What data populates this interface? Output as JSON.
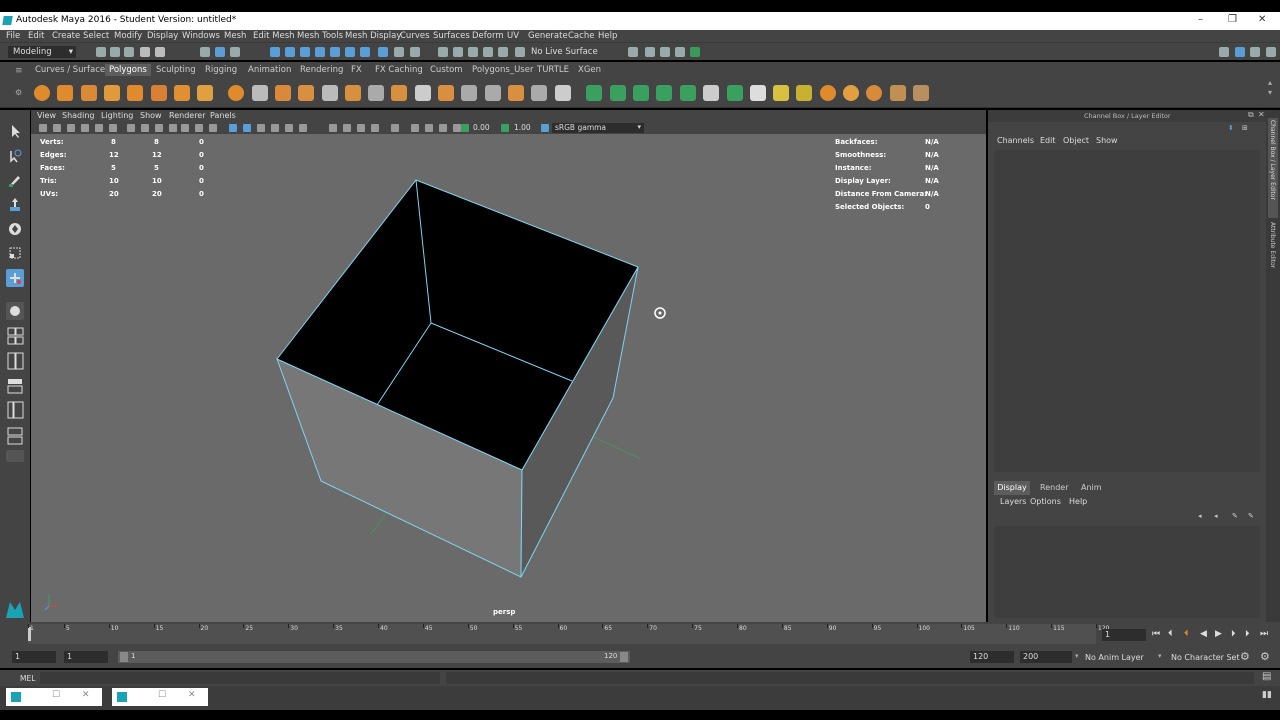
{
  "window": {
    "title": "Autodesk Maya 2016 - Student Version: untitled*",
    "controls": [
      "–",
      "❐",
      "✕"
    ]
  },
  "menubar": [
    "File",
    "Edit",
    "Create",
    "Select",
    "Modify",
    "Display",
    "Windows",
    "Mesh",
    "Edit Mesh",
    "Mesh Tools",
    "Mesh Display",
    "Curves",
    "Surfaces",
    "Deform",
    "UV",
    "Generate",
    "Cache",
    "Help"
  ],
  "statusline": {
    "mode": "Modeling",
    "live_surface": "No Live Surface"
  },
  "shelf": {
    "tabs": [
      "Curves / Surfaces",
      "Polygons",
      "Sculpting",
      "Rigging",
      "Animation",
      "Rendering",
      "FX",
      "FX Caching",
      "Custom",
      "Polygons_User",
      "TURTLE",
      "XGen"
    ],
    "active_tab": "Polygons"
  },
  "panel_menu": [
    "View",
    "Shading",
    "Lighting",
    "Show",
    "Renderer",
    "Panels"
  ],
  "panel_toolbar": {
    "value1": "0.00",
    "value2": "1.00",
    "color_space": "sRGB gamma"
  },
  "hud_left": [
    {
      "label": "Verts:",
      "v1": "8",
      "v2": "8",
      "v3": "0"
    },
    {
      "label": "Edges:",
      "v1": "12",
      "v2": "12",
      "v3": "0"
    },
    {
      "label": "Faces:",
      "v1": "5",
      "v2": "5",
      "v3": "0"
    },
    {
      "label": "Tris:",
      "v1": "10",
      "v2": "10",
      "v3": "0"
    },
    {
      "label": "UVs:",
      "v1": "20",
      "v2": "20",
      "v3": "0"
    }
  ],
  "hud_right": [
    {
      "label": "Backfaces:",
      "value": "N/A"
    },
    {
      "label": "Smoothness:",
      "value": "N/A"
    },
    {
      "label": "Instance:",
      "value": "N/A"
    },
    {
      "label": "Display Layer:",
      "value": "N/A"
    },
    {
      "label": "Distance From Camera:",
      "value": "N/A"
    },
    {
      "label": "Selected Objects:",
      "value": "0"
    }
  ],
  "camera_label": "persp",
  "channel_box": {
    "title": "Channel Box / Layer Editor",
    "menu": [
      "Channels",
      "Edit",
      "Object",
      "Show"
    ],
    "layer_tabs": [
      "Display",
      "Render",
      "Anim"
    ],
    "layer_menu": [
      "Layers",
      "Options",
      "Help"
    ]
  },
  "side_tabs": [
    "Channel Box / Layer Editor",
    "Attribute Editor"
  ],
  "timeline": {
    "ticks": [
      "1",
      "5",
      "10",
      "15",
      "20",
      "25",
      "30",
      "35",
      "40",
      "45",
      "50",
      "55",
      "60",
      "65",
      "70",
      "75",
      "80",
      "85",
      "90",
      "95",
      "100",
      "105",
      "110",
      "115",
      "120"
    ],
    "current_frame": "1"
  },
  "range": {
    "start": "1",
    "playback_start": "1",
    "slider_start": "1",
    "slider_end": "120",
    "playback_end": "120",
    "end": "200",
    "anim_layer": "No Anim Layer",
    "character_set": "No Character Set"
  },
  "command_line": {
    "label": "MEL"
  },
  "colors": {
    "accent": "#5a9ed8",
    "viewport": "#6a6a6a",
    "wire": "#7fd3f2"
  }
}
